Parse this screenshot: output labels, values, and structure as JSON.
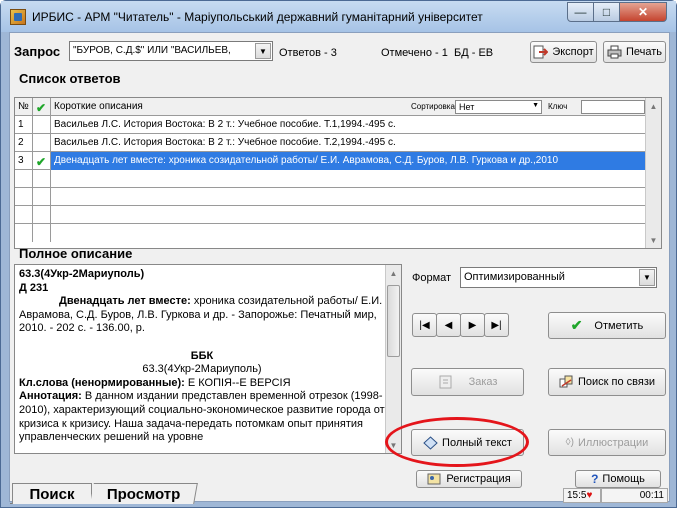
{
  "window": {
    "title": "ИРБИС - АРМ \"Читатель\" - Маріупольський державний гуманітарний університет",
    "controls": {
      "minimize": "—",
      "maximize": "□",
      "close": "✕"
    }
  },
  "toolbar": {
    "query_label": "Запрос",
    "query_value": "\"БУРОВ, С.Д.$\" ИЛИ \"ВАСИЛЬЕВ,",
    "answers": "Ответов - 3",
    "marked": "Отмечено - 1",
    "db": "БД - ЕВ",
    "export_label": "Экспорт",
    "print_label": "Печать"
  },
  "answers_list": {
    "title": "Список ответов",
    "header": {
      "num": "№",
      "desc": "Короткие описания",
      "sort_label": "Сортировка",
      "sort_value": "Нет",
      "key_label": "Ключ",
      "key_value": ""
    },
    "rows": [
      {
        "num": "1",
        "marked": false,
        "desc": "Васильев Л.С. История Востока: В 2 т.: Учебное пособие. Т.1,1994.-495 с."
      },
      {
        "num": "2",
        "marked": false,
        "desc": "Васильев Л.С. История Востока: В 2 т.: Учебное пособие. Т.2,1994.-495 с."
      },
      {
        "num": "3",
        "marked": true,
        "desc": "Двенадцать лет вместе: хроника созидательной работы/ Е.И. Аврамова, С.Д. Буров, Л.В. Гуркова и др.,2010"
      }
    ]
  },
  "full_description": {
    "title": "Полное описание",
    "code1": "63.3(4Укр-2Мариуполь)",
    "code2": "Д 231",
    "main_title_bold": "Двенадцать лет вместе:",
    "main_title_rest": " хроника созидательной работы/ Е.И. Аврамова, С.Д. Буров, Л.В. Гуркова и др. - Запорожье: Печатный мир, 2010. - 202 с. - 136.00,  р.",
    "bbk_label": "ББК",
    "bbk_value": "63.3(4Укр-2Мариуполь)",
    "keywords_label": "Кл.слова (ненормированные):",
    "keywords_value": " Е КОПІЯ--Е ВЕРСІЯ",
    "abstract_label": "Аннотация:",
    "abstract_value": " В данном издании представлен временной отрезок (1998-2010), характеризующий социально-экономическое развитие города от кризиса к кризису. Наша задача-передать потомкам опыт принятия управленческих решений на уровне"
  },
  "controls": {
    "format_label": "Формат",
    "format_value": "Оптимизированный",
    "nav_first": "|◀",
    "nav_prev": "◀",
    "nav_next": "▶",
    "nav_last": "▶|",
    "mark_label": "Отметить",
    "order_label": "Заказ",
    "link_search_label": "Поиск по связи",
    "fulltext_label": "Полный текст",
    "illustrations_label": "Иллюстрации"
  },
  "tabs": [
    {
      "label": "Поиск"
    },
    {
      "label": "Просмотр"
    }
  ],
  "bottom": {
    "registration_label": "Регистрация",
    "help_label": "Помощь",
    "time": "15:5",
    "elapsed": "00:11"
  }
}
